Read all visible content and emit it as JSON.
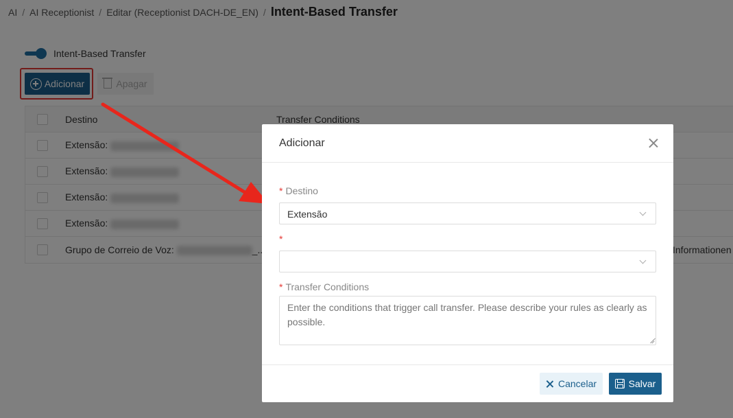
{
  "breadcrumb": {
    "items": [
      "AI",
      "AI Receptionist",
      "Editar (Receptionist DACH-DE_EN)"
    ],
    "separator": "/",
    "current": "Intent-Based Transfer"
  },
  "toggle": {
    "label": "Intent-Based Transfer",
    "on": true
  },
  "toolbar": {
    "add_label": "Adicionar",
    "delete_label": "Apagar"
  },
  "table": {
    "columns": [
      "Destino",
      "Transfer Conditions"
    ],
    "rows": [
      {
        "destino": "Extensão: ",
        "conditions": ""
      },
      {
        "destino": "Extensão: ",
        "conditions": ""
      },
      {
        "destino": "Extensão: ",
        "conditions": ""
      },
      {
        "destino": "Extensão: ",
        "conditions": ""
      },
      {
        "destino": "Grupo de Correio de Voz: ",
        "suffix": "_...",
        "conditions": "Informationen"
      }
    ]
  },
  "modal": {
    "title": "Adicionar",
    "fields": {
      "destino_label": "Destino",
      "destino_value": "Extensão",
      "second_label": "",
      "second_value": "",
      "conditions_label": "Transfer Conditions",
      "conditions_placeholder": "Enter the conditions that trigger call transfer. Please describe your rules as clearly as possible."
    },
    "required_mark": "*",
    "cancel_label": "Cancelar",
    "save_label": "Salvar"
  },
  "colors": {
    "primary": "#1b5f8c",
    "required": "#e53935",
    "annotation": "#e53935"
  }
}
